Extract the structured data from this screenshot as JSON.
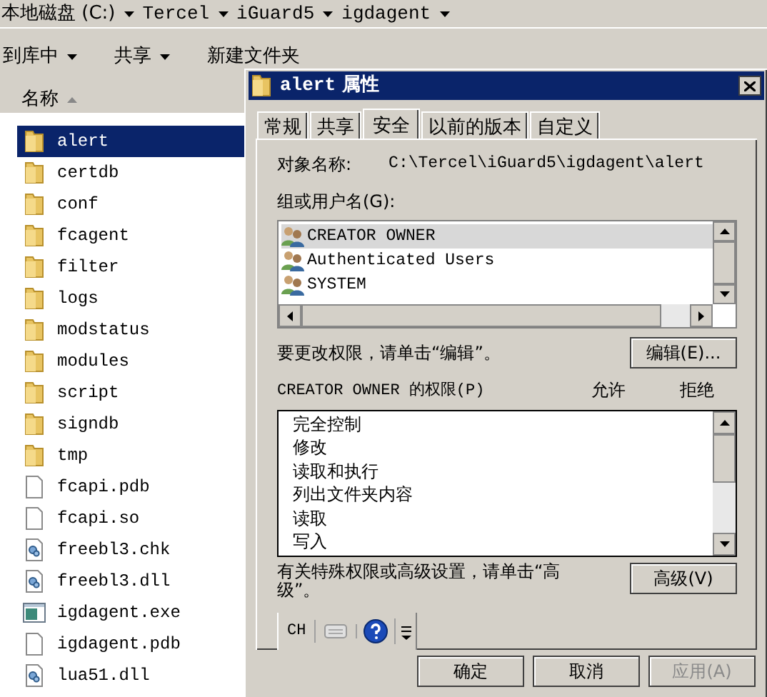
{
  "address_bar": {
    "crumbs": [
      "本地磁盘 (C:)",
      "Tercel",
      "iGuard5",
      "igdagent"
    ]
  },
  "toolbar": {
    "items": [
      {
        "label": "到库中",
        "dropdown": true
      },
      {
        "label": "共享",
        "dropdown": true
      },
      {
        "label": "新建文件夹",
        "dropdown": false
      }
    ]
  },
  "file_list": {
    "column": "名称",
    "rows": [
      {
        "name": "alert",
        "kind": "folder",
        "selected": true
      },
      {
        "name": "certdb",
        "kind": "folder",
        "selected": false
      },
      {
        "name": "conf",
        "kind": "folder",
        "selected": false
      },
      {
        "name": "fcagent",
        "kind": "folder",
        "selected": false
      },
      {
        "name": "filter",
        "kind": "folder",
        "selected": false
      },
      {
        "name": "logs",
        "kind": "folder",
        "selected": false
      },
      {
        "name": "modstatus",
        "kind": "folder",
        "selected": false
      },
      {
        "name": "modules",
        "kind": "folder",
        "selected": false
      },
      {
        "name": "script",
        "kind": "folder",
        "selected": false
      },
      {
        "name": "signdb",
        "kind": "folder",
        "selected": false
      },
      {
        "name": "tmp",
        "kind": "folder",
        "selected": false
      },
      {
        "name": "fcapi.pdb",
        "kind": "file",
        "selected": false
      },
      {
        "name": "fcapi.so",
        "kind": "file",
        "selected": false
      },
      {
        "name": "freebl3.chk",
        "kind": "dll",
        "selected": false
      },
      {
        "name": "freebl3.dll",
        "kind": "dll",
        "selected": false
      },
      {
        "name": "igdagent.exe",
        "kind": "exe",
        "selected": false
      },
      {
        "name": "igdagent.pdb",
        "kind": "file",
        "selected": false
      },
      {
        "name": "lua51.dll",
        "kind": "dll",
        "selected": false
      }
    ]
  },
  "dialog": {
    "title_name": "alert",
    "title_suffix": "属性",
    "tabs": [
      {
        "label": "常规",
        "selected": false
      },
      {
        "label": "共享",
        "selected": false
      },
      {
        "label": "安全",
        "selected": true
      },
      {
        "label": "以前的版本",
        "selected": false
      },
      {
        "label": "自定义",
        "selected": false
      }
    ],
    "object_label": "对象名称:",
    "object_value": "C:\\Tercel\\iGuard5\\igdagent\\alert",
    "groups_label": "组或用户名(G):",
    "users": [
      {
        "name": "CREATOR OWNER",
        "selected": true
      },
      {
        "name": "Authenticated Users",
        "selected": false
      },
      {
        "name": "SYSTEM",
        "selected": false
      }
    ],
    "edit_hint": "要更改权限，请单击“编辑”。",
    "edit_button": "编辑(E)...",
    "perm_label": "CREATOR OWNER 的权限(P)",
    "allow_header": "允许",
    "deny_header": "拒绝",
    "permissions": [
      "完全控制",
      "修改",
      "读取和执行",
      "列出文件夹内容",
      "读取",
      "写入"
    ],
    "advanced_hint": "有关特殊权限或高级设置，请单击“高级”。",
    "advanced_button": "高级(V)",
    "buttons": [
      {
        "label": "确定",
        "disabled": false
      },
      {
        "label": "取消",
        "disabled": false
      },
      {
        "label": "应用(A)",
        "disabled": true
      }
    ]
  },
  "ime_bar": {
    "lang": "CH"
  }
}
